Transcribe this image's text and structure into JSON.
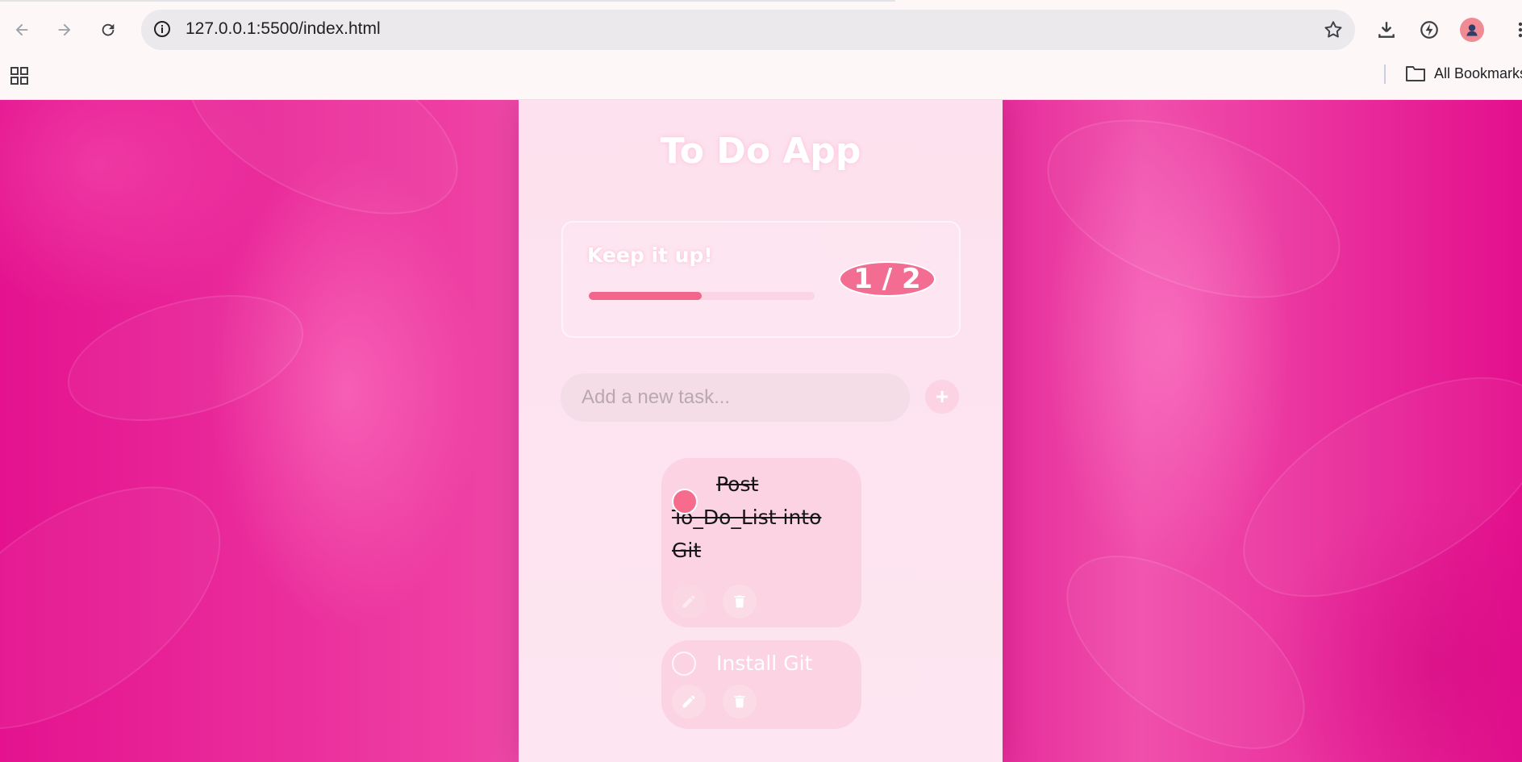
{
  "browser": {
    "url": "127.0.0.1:5500/index.html",
    "bookmarks_label": "All Bookmarks"
  },
  "app": {
    "title": "To Do App",
    "stats": {
      "message": "Keep it up!",
      "completed": 1,
      "total": 2,
      "counter_text": "1 / 2",
      "progress_fraction": 0.5
    },
    "input": {
      "placeholder": "Add a new task...",
      "value": ""
    },
    "add_button_label": "+",
    "tasks": [
      {
        "text": "Post To_Do_List into Git",
        "completed": true
      },
      {
        "text": "Install Git",
        "completed": false
      }
    ]
  },
  "colors": {
    "accent": "#f36d93",
    "background": "#e4128f",
    "card": "#fde1ee"
  }
}
